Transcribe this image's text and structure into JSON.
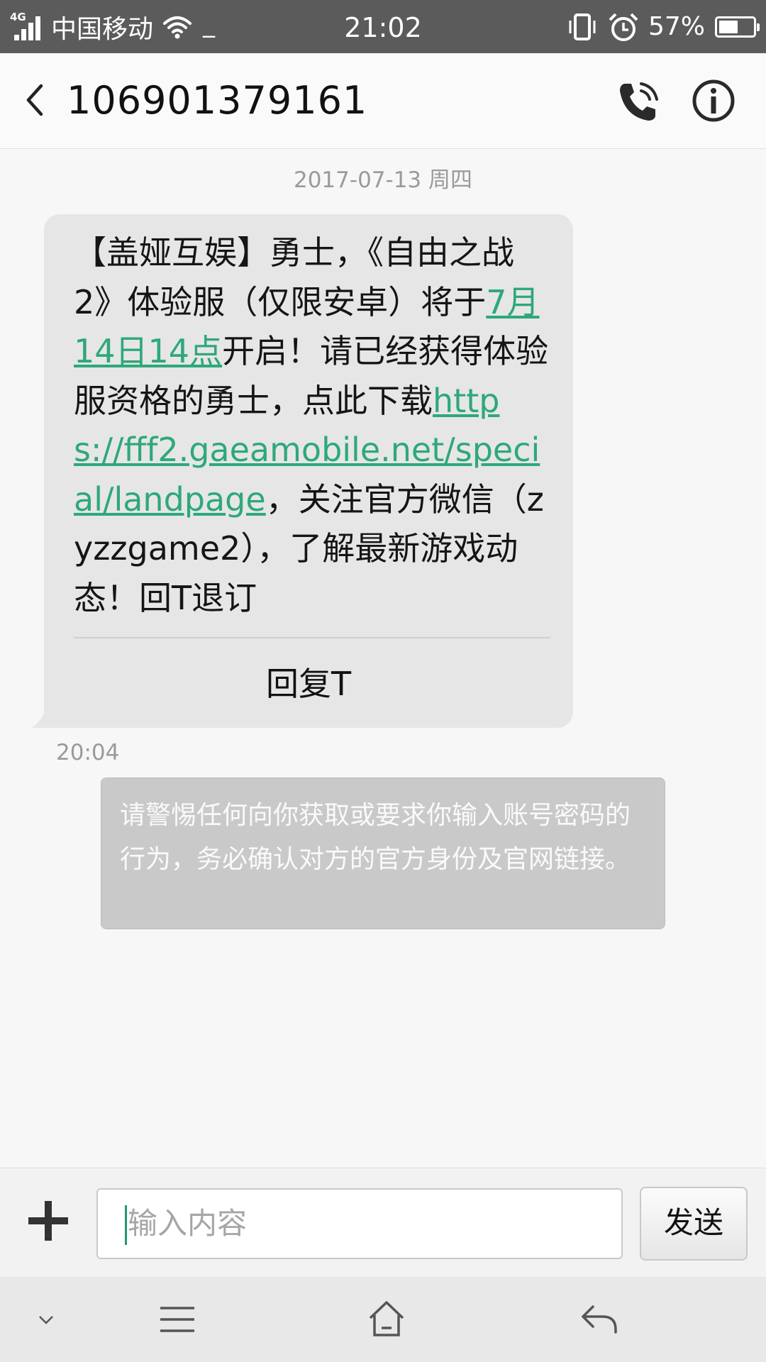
{
  "status_bar": {
    "network": "4G",
    "carrier": "中国移动",
    "extra": "_",
    "time": "21:02",
    "battery_percent": "57%",
    "battery_level": 0.57
  },
  "header": {
    "title": "106901379161"
  },
  "conversation": {
    "date": "2017-07-13 周四",
    "message": {
      "text_1": "【盖娅互娱】勇士，《自由之战2》体验服（仅限安卓）将于",
      "link_date": "7月14日14点",
      "text_2": "开启！请已经获得体验服资格的勇士，点此下载",
      "link_url": "https://fff2.gaeamobile.net/special/landpage",
      "text_3": "，关注官方微信（zyzzgame2），了解最新游戏动态！回T退订",
      "reply_label": "回复T"
    },
    "time": "20:04",
    "warning": "请警惕任何向你获取或要求你输入账号密码的行为，务必确认对方的官方身份及官网链接。"
  },
  "compose": {
    "placeholder": "输入内容",
    "send_label": "发送"
  },
  "colors": {
    "status_bar": "#5b5b5b",
    "link": "#2ea87a",
    "bubble": "#e6e6e6",
    "warning_bg": "#c9c9c9"
  }
}
